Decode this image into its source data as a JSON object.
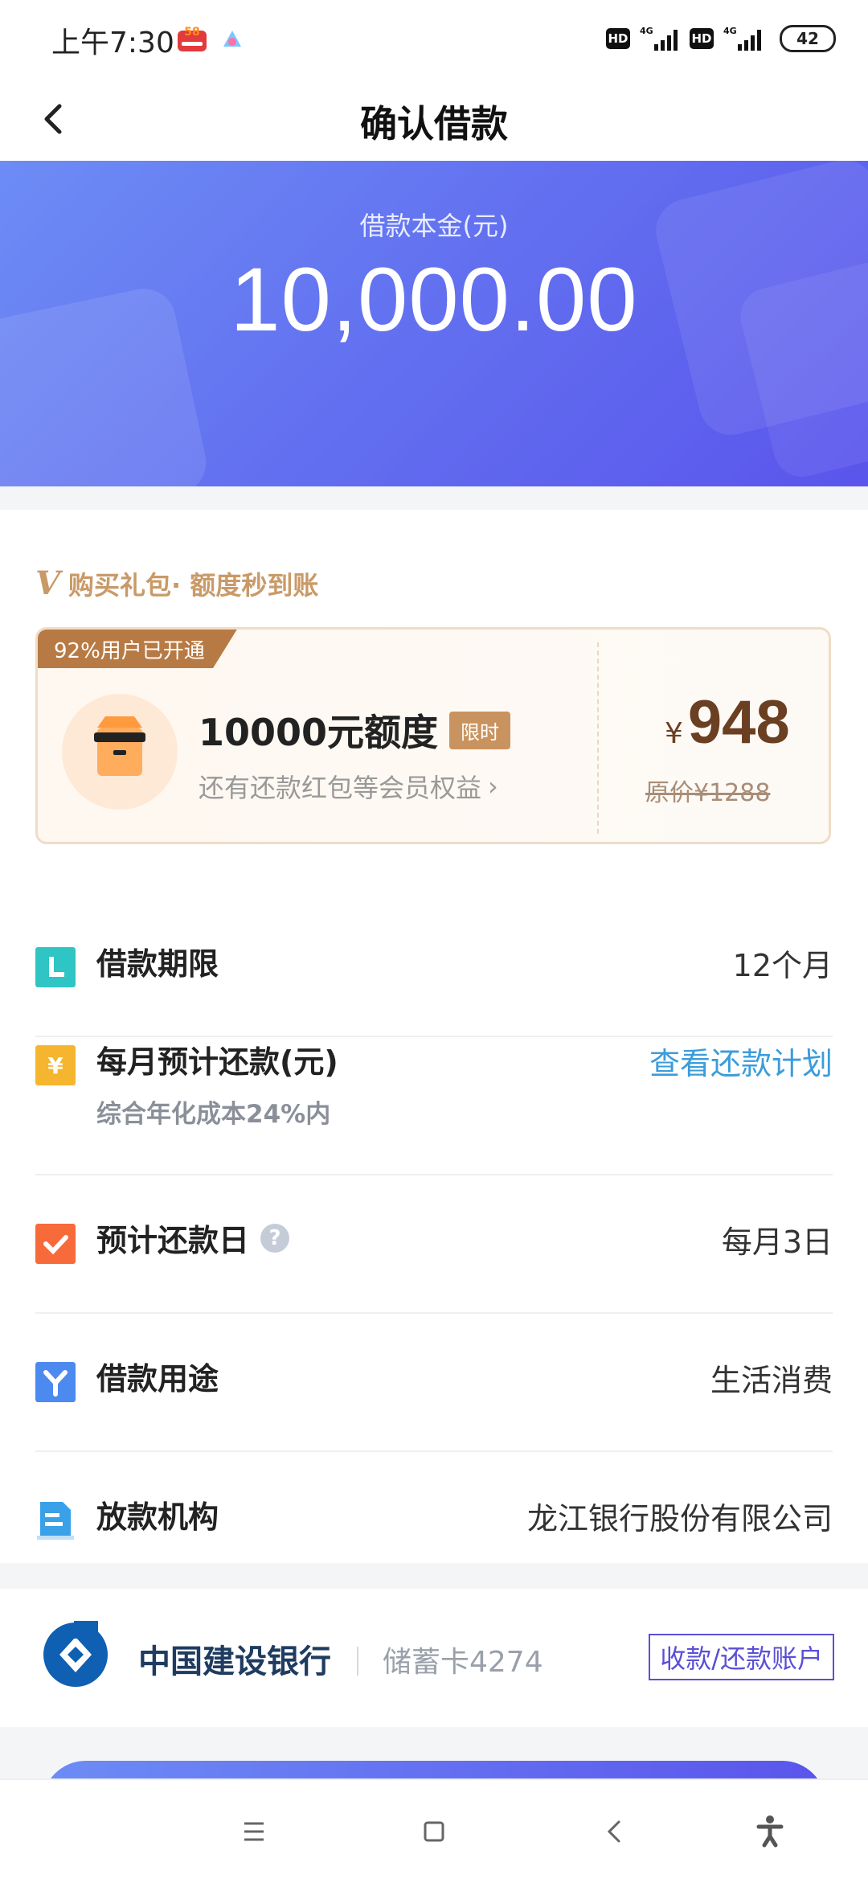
{
  "status_bar": {
    "time": "上午7:30",
    "app_badge": "58",
    "hd_label": "HD",
    "network": "4G",
    "battery": "42"
  },
  "nav": {
    "title": "确认借款"
  },
  "hero": {
    "label": "借款本金(元)",
    "amount": "10,000.00"
  },
  "promo": {
    "header_v": "V",
    "header_text": "购买礼包· 额度秒到账",
    "ribbon": "92%用户已开通",
    "title": "10000元额度",
    "badge": "限时",
    "subtitle": "还有还款红包等会员权益",
    "subtitle_arrow": "›",
    "price_symbol": "¥",
    "price": "948",
    "original_price": "原价¥1288"
  },
  "rows": [
    {
      "label": "借款期限",
      "value": "12个月",
      "icon": "calendar-icon",
      "color": "#2ec5c4"
    },
    {
      "label": "每月预计还款(元)",
      "sub": "综合年化成本24%内",
      "link": "查看还款计划",
      "icon": "yen-icon",
      "color": "#f5b52e"
    },
    {
      "label": "预计还款日",
      "help": "?",
      "value": "每月3日",
      "icon": "check-icon",
      "color": "#f76a3a"
    },
    {
      "label": "借款用途",
      "value": "生活消费",
      "icon": "purpose-icon",
      "color": "#4d8af0"
    },
    {
      "label": "放款机构",
      "value": "龙江银行股份有限公司",
      "icon": "document-icon",
      "color": "#3aa0e8"
    }
  ],
  "bank": {
    "name": "中国建设银行",
    "card": "储蓄卡4274",
    "account_button": "收款/还款账户"
  },
  "colors": {
    "primary": "#5a55ec",
    "promo_gold": "#c99a68",
    "link_blue": "#3b9cdb"
  }
}
